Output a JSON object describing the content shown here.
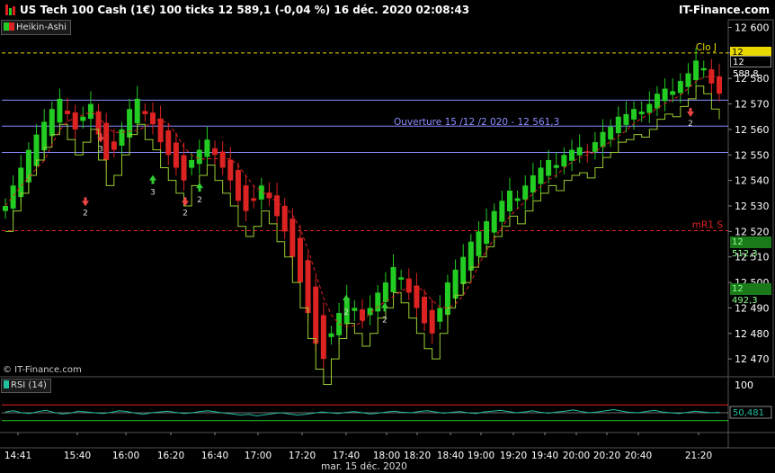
{
  "header": {
    "title": "US Tech 100 Cash (1€) 100 ticks 12 589,1 (-0,04 %) 16 déc. 2020 02:08:43",
    "brand": "IT-Finance.com"
  },
  "indicator_label": "Heikin-Ashi",
  "rsi_label": "RSI (14)",
  "copyright": "© IT-Finance.com",
  "colors": {
    "up": "#22cc22",
    "down": "#dd2222",
    "level": "#8c8cff",
    "signal_up": "#33cc33",
    "signal_down": "#ee4444"
  },
  "chart_data": {
    "type": "line",
    "y_ticks": [
      "12 600",
      "12 590",
      "12 580",
      "12 570",
      "12 560",
      "12 550",
      "12 540",
      "12 530",
      "12 520",
      "12 510",
      "12 500",
      "12 490",
      "12 480",
      "12 470"
    ],
    "ylim": [
      12463,
      12603
    ],
    "x_ticks": [
      "14:41",
      "15:40",
      "16:00",
      "16:20",
      "16:40",
      "17:00",
      "17:20",
      "17:40",
      "18:00",
      "18:20",
      "18:40",
      "19:00",
      "19:20",
      "19:40",
      "20:00",
      "20:20",
      "20:40",
      "21:20"
    ],
    "x_date_label": "mar. 15 déc. 2020",
    "levels": [
      {
        "name": "Ouverture 15 /12 /2 020  - 12 561,3",
        "value": 12561.3,
        "color": "#8c8cff",
        "style": "solid"
      },
      {
        "name": "",
        "value": 12571.5,
        "color": "#8c8cff",
        "style": "solid"
      },
      {
        "name": "",
        "value": 12551.0,
        "color": "#8c8cff",
        "style": "solid"
      },
      {
        "name": "Clo J",
        "value": 12590.0,
        "color": "#e8d800",
        "style": "dashed"
      },
      {
        "name": "mR1 S",
        "value": 12520.3,
        "color": "#dd2222",
        "style": "dashed"
      }
    ],
    "price_tags": [
      {
        "value": "12 590,1",
        "color": "#e8d800",
        "text": "#000000"
      },
      {
        "value": "12 588,8",
        "color": "#000000",
        "text": "#ffffff"
      },
      {
        "value": "12 512,3",
        "color": "#1a7a1a",
        "text": "#88ff88"
      },
      {
        "value": "12 492,3",
        "color": "#1a7a1a",
        "text": "#88ff88"
      }
    ],
    "signal_labels": [
      "2",
      "3",
      "3",
      "2",
      "2",
      "2",
      "2",
      "2"
    ],
    "series": [
      {
        "close": [
          12530,
          12538,
          12545,
          12552,
          12558,
          12563,
          12568,
          12572,
          12566,
          12560,
          12565,
          12570,
          12558,
          12548,
          12552,
          12560,
          12568,
          12572,
          12566,
          12562,
          12555,
          12550,
          12545,
          12540,
          12548,
          12552,
          12556,
          12550,
          12545,
          12540,
          12532,
          12528,
          12532,
          12538,
          12533,
          12526,
          12520,
          12510,
          12500,
          12488,
          12476,
          12470,
          12480,
          12488,
          12494,
          12490,
          12485,
          12490,
          12496,
          12500,
          12506,
          12502,
          12496,
          12490,
          12484,
          12480,
          12490,
          12500,
          12505,
          12510,
          12516,
          12520,
          12524,
          12528,
          12532,
          12536,
          12533,
          12538,
          12542,
          12545,
          12548,
          12546,
          12550,
          12552,
          12553,
          12551,
          12555,
          12559,
          12561,
          12565,
          12566,
          12568,
          12567,
          12570,
          12574,
          12576,
          12575,
          12579,
          12582,
          12587,
          12584,
          12578,
          12574
        ]
      }
    ],
    "rsi": {
      "value": "50,481",
      "level_hi": 70,
      "level_lo": 30,
      "tick": "100",
      "values": [
        52,
        55,
        50,
        48,
        53,
        56,
        51,
        47,
        49,
        54,
        52,
        50,
        48,
        51,
        55,
        53,
        49,
        46,
        50,
        52,
        54,
        51,
        48,
        50,
        53,
        55,
        52,
        49,
        47,
        44,
        46,
        42,
        45,
        48,
        50,
        47,
        44,
        46,
        49,
        52,
        50,
        48,
        51,
        53,
        50,
        47,
        49,
        52,
        54,
        51,
        50,
        53,
        55,
        52,
        49,
        51,
        53,
        50,
        48,
        52,
        54,
        56,
        53,
        50,
        52,
        55,
        51,
        49,
        52,
        54,
        57,
        53,
        50,
        52,
        55,
        58,
        54,
        51,
        50,
        53,
        56,
        52,
        50,
        48,
        51,
        54,
        52,
        50,
        51
      ]
    }
  }
}
